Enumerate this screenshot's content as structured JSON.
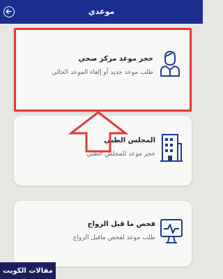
{
  "header": {
    "title": "موعدي"
  },
  "cards": [
    {
      "title": "حجز موعد مركز صحي",
      "subtitle": "طلب موعد جديد أو إلغاء الموعد الحالي"
    },
    {
      "title": "المجلس الطبي",
      "subtitle": "حجز موعد للمجلس الطبي"
    },
    {
      "title": "فحص ما قبل الزواج",
      "subtitle": "طلب موعد لفحص ماقبل الزواج"
    }
  ],
  "watermark": "مقالات الكويت",
  "colors": {
    "header": "#1b2e8f",
    "highlight": "#e23a3a",
    "icon": "#1f3b8f"
  },
  "icons": [
    "back-arrow-icon",
    "doctor-icon",
    "hospital-building-icon",
    "heart-monitor-icon",
    "up-arrow-annotation"
  ]
}
